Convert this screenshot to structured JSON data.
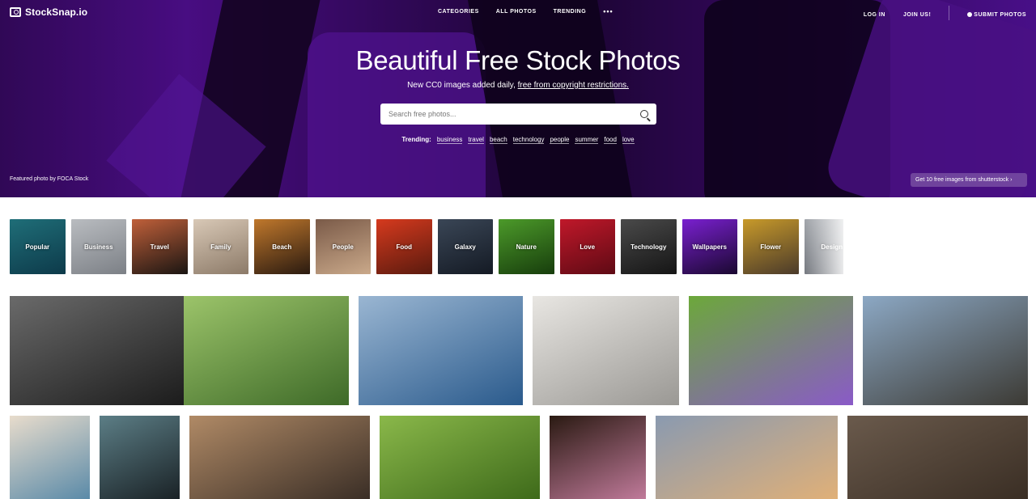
{
  "brand": {
    "name": "StockSnap.io"
  },
  "nav": {
    "center": [
      "CATEGORIES",
      "ALL PHOTOS",
      "TRENDING"
    ],
    "more": "•••",
    "login": "LOG IN",
    "join": "JOIN US!",
    "submit": "SUBMIT PHOTOS"
  },
  "hero": {
    "title": "Beautiful Free Stock Photos",
    "subtitle_prefix": "New CC0 images added daily,",
    "subtitle_link": "free from copyright restrictions.",
    "search_placeholder": "Search free photos...",
    "trending_label": "Trending:",
    "trending": [
      "business",
      "travel",
      "beach",
      "technology",
      "people",
      "summer",
      "food",
      "love"
    ],
    "featured_prefix": "Featured photo by",
    "featured_author": "FOCA Stock",
    "promo": "Get 10 free images from shutterstock ›"
  },
  "categories": [
    {
      "label": "Popular",
      "colors": [
        "#1f6e78",
        "#0d3a4a"
      ]
    },
    {
      "label": "Business",
      "colors": [
        "#b9bcc0",
        "#7c8086"
      ]
    },
    {
      "label": "Travel",
      "colors": [
        "#c0603a",
        "#1a1512"
      ]
    },
    {
      "label": "Family",
      "colors": [
        "#d8c8b6",
        "#8c7a68"
      ]
    },
    {
      "label": "Beach",
      "colors": [
        "#c0782c",
        "#2a1a10"
      ]
    },
    {
      "label": "People",
      "colors": [
        "#7a5a48",
        "#caa98a"
      ]
    },
    {
      "label": "Food",
      "colors": [
        "#d63a1e",
        "#5a1a0e"
      ]
    },
    {
      "label": "Galaxy",
      "colors": [
        "#3a4656",
        "#141a24"
      ]
    },
    {
      "label": "Nature",
      "colors": [
        "#4c9a2a",
        "#173d0c"
      ]
    },
    {
      "label": "Love",
      "colors": [
        "#c0182a",
        "#5e0a14"
      ]
    },
    {
      "label": "Technology",
      "colors": [
        "#4a4a4a",
        "#151515"
      ]
    },
    {
      "label": "Wallpapers",
      "colors": [
        "#7a20d0",
        "#1a0830"
      ]
    },
    {
      "label": "Flower",
      "colors": [
        "#c89a2a",
        "#4a3a2a"
      ]
    },
    {
      "label": "Design",
      "colors": [
        "#9a9ea4",
        "#5a5e66"
      ]
    }
  ],
  "photos": {
    "row1": [
      {
        "name": "vintage-kitchen-photo",
        "colors": [
          "#6a6a6a",
          "#1c1c1c"
        ]
      },
      {
        "name": "family-picnic-photo",
        "colors": [
          "#9cc46a",
          "#3e6a28"
        ]
      },
      {
        "name": "sailboat-photo",
        "colors": [
          "#9ab6d2",
          "#2a5a8c"
        ]
      },
      {
        "name": "notebook-pen-photo",
        "colors": [
          "#e8e6e2",
          "#9a9894"
        ]
      },
      {
        "name": "purple-flower-photo",
        "colors": [
          "#6ca83a",
          "#8a5ac8"
        ]
      },
      {
        "name": "city-street-photo",
        "colors": [
          "#8ca8c4",
          "#3c3a34"
        ]
      }
    ],
    "row2": [
      {
        "name": "couple-cooking-photo",
        "colors": [
          "#e8dccc",
          "#5a8aa8"
        ]
      },
      {
        "name": "woman-portrait-photo",
        "colors": [
          "#5c7e86",
          "#1a2226"
        ]
      },
      {
        "name": "seal-rocks-photo",
        "colors": [
          "#b08a66",
          "#3a2e26"
        ]
      },
      {
        "name": "strawberries-photo",
        "colors": [
          "#8ab84a",
          "#3e6a1a"
        ]
      },
      {
        "name": "flower-vase-photo",
        "colors": [
          "#2a1a12",
          "#c07a9a"
        ]
      },
      {
        "name": "sunset-clouds-photo",
        "colors": [
          "#8a9ab0",
          "#e0b078"
        ]
      },
      {
        "name": "plant-wall-photo",
        "colors": [
          "#6a5a4c",
          "#3a2e24"
        ]
      }
    ]
  }
}
